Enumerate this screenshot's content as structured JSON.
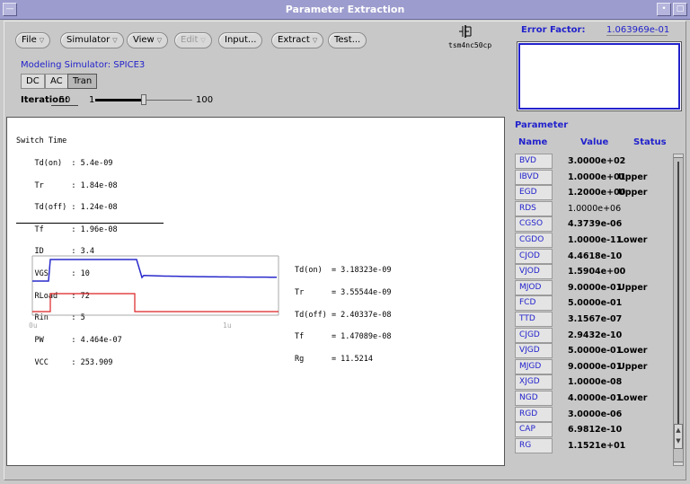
{
  "window": {
    "title": "Parameter Extraction",
    "menu_icon": "window-menu-icon",
    "minimize_icon": "minimize-icon",
    "maximize_icon": "maximize-icon"
  },
  "menu": {
    "file": "File",
    "simulator": "Simulator",
    "view": "View",
    "edit": "Edit",
    "input": "Input...",
    "extract": "Extract",
    "test": "Test..."
  },
  "device": {
    "icon": "mosfet-icon",
    "label": "tsm4nc50cp"
  },
  "simulator": {
    "label": "Modeling Simulator: SPICE3",
    "modes": [
      "DC",
      "AC",
      "Tran"
    ],
    "active_mode": "Tran"
  },
  "iteration": {
    "label": "Iteration:",
    "value": "50",
    "min": "1",
    "max": "100",
    "position": 0.5
  },
  "error_factor": {
    "label": "Error Factor:",
    "value": "1.063969e-01"
  },
  "spec": {
    "title": "Switch Time",
    "rows": [
      "    Td(on)  : 5.4e-09",
      "    Tr      : 1.84e-08",
      "    Td(off) : 1.24e-08",
      "    Tf      : 1.96e-08",
      "    ID      : 3.4",
      "    VGS     : 10",
      "    RLoad   : 72",
      "    Rin     : 5",
      "    PW      : 4.464e-07",
      "    VCC     : 253.909"
    ]
  },
  "plot": {
    "x_start_label": "0u",
    "x_end_label": "1u",
    "colors": {
      "drain": "#2a2acc",
      "gate": "#dd2222",
      "axis": "#aaaaaa"
    }
  },
  "results": {
    "rows": [
      "Td(on)  = 3.18323e-09",
      "Tr      = 3.55544e-09",
      "Td(off) = 2.40337e-08",
      "Tf      = 1.47089e-08",
      "Rg      = 11.5214"
    ]
  },
  "parameters": {
    "title": "Parameter",
    "headers": {
      "name": "Name",
      "value": "Value",
      "status": "Status"
    },
    "rows": [
      {
        "name": "BVD",
        "value": "3.0000e+02",
        "status": ""
      },
      {
        "name": "IBVD",
        "value": "1.0000e+01",
        "status": "Upper"
      },
      {
        "name": "EGD",
        "value": "1.2000e+00",
        "status": "Upper"
      },
      {
        "name": "RDS",
        "value": "1.0000e+06",
        "status": ""
      },
      {
        "name": "CGSO",
        "value": "4.3739e-06",
        "status": ""
      },
      {
        "name": "CGDO",
        "value": "1.0000e-11",
        "status": "Lower"
      },
      {
        "name": "CJOD",
        "value": "4.4618e-10",
        "status": ""
      },
      {
        "name": "VJOD",
        "value": "1.5904e+00",
        "status": ""
      },
      {
        "name": "MJOD",
        "value": "9.0000e-01",
        "status": "Upper"
      },
      {
        "name": "FCD",
        "value": "5.0000e-01",
        "status": ""
      },
      {
        "name": "TTD",
        "value": "3.1567e-07",
        "status": ""
      },
      {
        "name": "CJGD",
        "value": "2.9432e-10",
        "status": ""
      },
      {
        "name": "VJGD",
        "value": "5.0000e-01",
        "status": "Lower"
      },
      {
        "name": "MJGD",
        "value": "9.0000e-01",
        "status": "Upper"
      },
      {
        "name": "XJGD",
        "value": "1.0000e-08",
        "status": ""
      },
      {
        "name": "NGD",
        "value": "4.0000e-01",
        "status": "Lower"
      },
      {
        "name": "RGD",
        "value": "3.0000e-06",
        "status": ""
      },
      {
        "name": "CAP",
        "value": "6.9812e-10",
        "status": ""
      },
      {
        "name": "RG",
        "value": "1.1521e+01",
        "status": ""
      }
    ]
  }
}
